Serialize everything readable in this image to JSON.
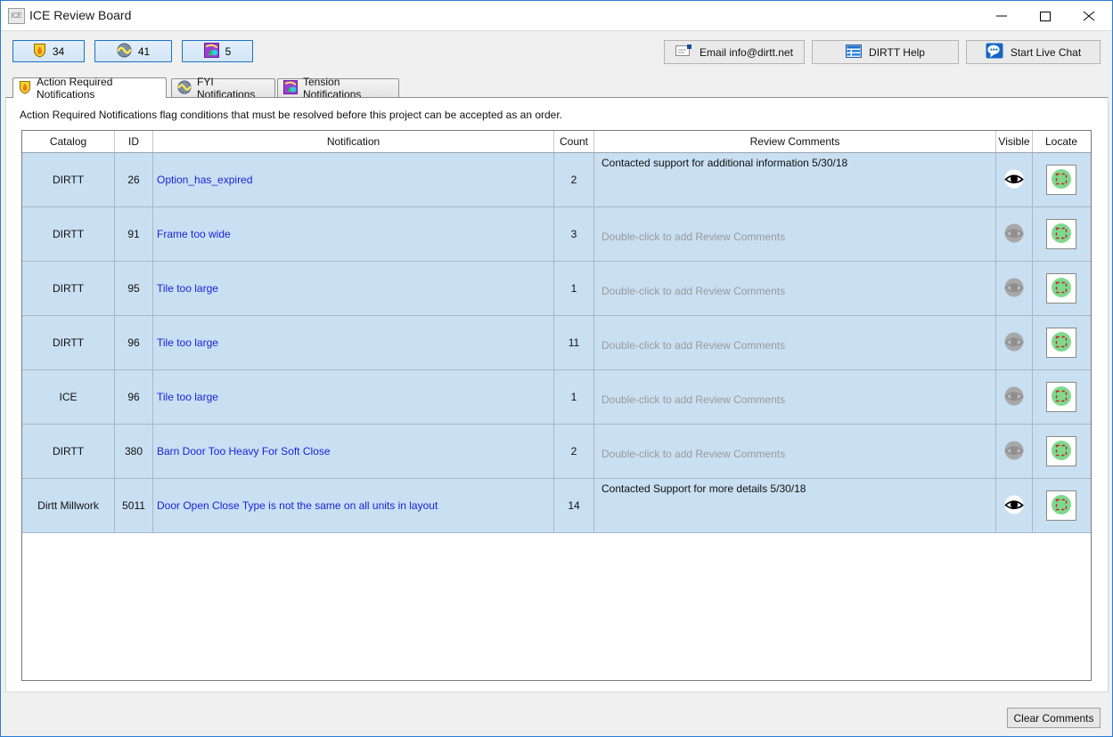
{
  "window": {
    "title": "ICE Review Board",
    "icon_label": "ICE",
    "icon_name": "ice-app-icon",
    "controls": {
      "minimize": "minimize",
      "maximize": "maximize",
      "close": "close"
    }
  },
  "toolbar": {
    "counters": [
      {
        "name": "action-required",
        "icon": "shield-flame-icon",
        "count": "34"
      },
      {
        "name": "fyi",
        "icon": "fyi-circle-icon",
        "count": "41"
      },
      {
        "name": "tension",
        "icon": "tension-shapes-icon",
        "count": "5"
      }
    ],
    "commands": [
      {
        "name": "email",
        "icon": "envelope-icon",
        "label": "Email info@dirtt.net"
      },
      {
        "name": "help",
        "icon": "table-grid-icon",
        "label": "DIRTT Help"
      },
      {
        "name": "chat",
        "icon": "chat-bubble-icon",
        "label": "Start Live Chat"
      }
    ]
  },
  "tabs": [
    {
      "name": "action-required-notifications",
      "label": "Action Required Notifications",
      "icon": "shield-flame-icon",
      "active": true
    },
    {
      "name": "fyi-notifications",
      "label": "FYI Notifications",
      "icon": "fyi-circle-icon",
      "active": false
    },
    {
      "name": "tension-notifications",
      "label": "Tension Notifications",
      "icon": "tension-shapes-icon",
      "active": false
    }
  ],
  "main": {
    "description": "Action Required Notifications flag conditions that must be resolved before this project can be accepted as an order.",
    "grid": {
      "columns": [
        {
          "key": "catalog",
          "label": "Catalog"
        },
        {
          "key": "id",
          "label": "ID"
        },
        {
          "key": "notification",
          "label": "Notification"
        },
        {
          "key": "count",
          "label": "Count"
        },
        {
          "key": "review_comments",
          "label": "Review Comments"
        },
        {
          "key": "visible",
          "label": "Visible"
        },
        {
          "key": "locate",
          "label": "Locate"
        }
      ],
      "comment_placeholder": "Double-click to add Review Comments",
      "rows": [
        {
          "catalog": "DIRTT",
          "id": "26",
          "notification": "Option_has_expired",
          "count": "2",
          "review_comments": "Contacted support for additional information 5/30/18",
          "has_comment": true,
          "visible_active": true
        },
        {
          "catalog": "DIRTT",
          "id": "91",
          "notification": "Frame too wide",
          "count": "3",
          "review_comments": "",
          "has_comment": false,
          "visible_active": false
        },
        {
          "catalog": "DIRTT",
          "id": "95",
          "notification": "Tile too large",
          "count": "1",
          "review_comments": "",
          "has_comment": false,
          "visible_active": false
        },
        {
          "catalog": "DIRTT",
          "id": "96",
          "notification": "Tile too large",
          "count": "11",
          "review_comments": "",
          "has_comment": false,
          "visible_active": false
        },
        {
          "catalog": "ICE",
          "id": "96",
          "notification": "Tile too large",
          "count": "1",
          "review_comments": "",
          "has_comment": false,
          "visible_active": false
        },
        {
          "catalog": "DIRTT",
          "id": "380",
          "notification": "Barn Door Too Heavy For Soft Close",
          "count": "2",
          "review_comments": "",
          "has_comment": false,
          "visible_active": false
        },
        {
          "catalog": "Dirtt Millwork",
          "id": "5011",
          "notification": "Door Open Close Type is not the same on all units in layout",
          "count": "14",
          "review_comments": "Contacted Support for more details 5/30/18",
          "has_comment": true,
          "visible_active": true
        }
      ]
    }
  },
  "footer": {
    "clear_comments_label": "Clear Comments"
  },
  "colors": {
    "window_border": "#2b7cd3",
    "row_background": "#c9dff2",
    "link_text": "#1a24d8",
    "placeholder_text": "#9a9a9a",
    "locate_green": "#7ed98f",
    "locate_marker_red": "#d02020",
    "chrome_gray": "#f0f0f0"
  }
}
